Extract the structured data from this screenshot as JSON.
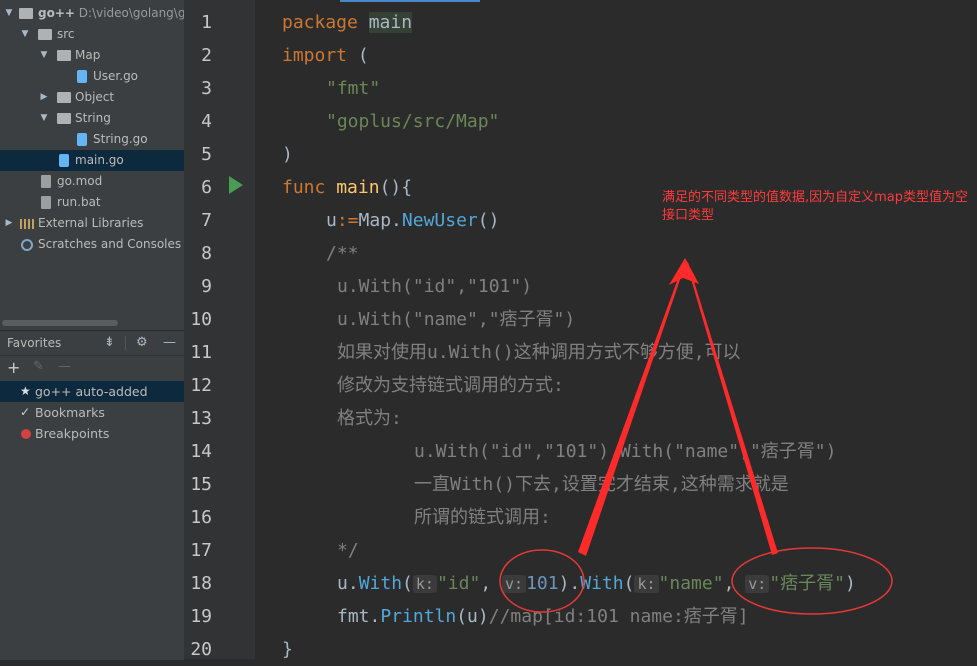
{
  "project_tree": [
    {
      "label": "go++",
      "path": "D:\\video\\golang\\g",
      "type": "root",
      "expanded": true
    },
    {
      "label": "src",
      "type": "folder",
      "expanded": true
    },
    {
      "label": "Map",
      "type": "folder",
      "expanded": true
    },
    {
      "label": "User.go",
      "type": "gofile"
    },
    {
      "label": "Object",
      "type": "folder",
      "expanded": false
    },
    {
      "label": "String",
      "type": "folder",
      "expanded": true
    },
    {
      "label": "String.go",
      "type": "gofile"
    },
    {
      "label": "main.go",
      "type": "gofile",
      "selected": true
    },
    {
      "label": "go.mod",
      "type": "modfile"
    },
    {
      "label": "run.bat",
      "type": "modfile"
    },
    {
      "label": "External Libraries",
      "type": "extlib",
      "expanded": false
    },
    {
      "label": "Scratches and Consoles",
      "type": "scratch"
    }
  ],
  "favorites": {
    "title": "Favorites",
    "items": [
      {
        "label": "go++  auto-added",
        "icon": "star-icon",
        "selected": true
      },
      {
        "label": "Bookmarks",
        "icon": "check-icon"
      },
      {
        "label": "Breakpoints",
        "icon": "breakpoint-icon"
      }
    ]
  },
  "line_numbers": [
    "1",
    "2",
    "3",
    "4",
    "5",
    "6",
    "7",
    "8",
    "9",
    "10",
    "11",
    "12",
    "13",
    "14",
    "15",
    "16",
    "17",
    "18",
    "19",
    "20"
  ],
  "code": {
    "l1_kw": "package",
    "l1_name": "main",
    "l2_kw": "import",
    "l2_paren": " (",
    "l3_str": "\"fmt\"",
    "l4_str": "\"goplus/src/Map\"",
    "l5": ")",
    "l6_kw": "func",
    "l6_fn": "main",
    "l6_rest": "(){",
    "l7_a": "u",
    "l7_op": ":=",
    "l7_b": "Map.",
    "l7_c": "NewUser",
    "l7_d": "()",
    "l8": "/**",
    "l9": "u.With(\"id\",\"101\")",
    "l10": "u.With(\"name\",\"痞子胥\")",
    "l11": "如果对使用u.With()这种调用方式不够方便,可以",
    "l12": "修改为支持链式调用的方式:",
    "l13": "格式为:",
    "l14": "u.With(\"id\",\"101\").With(\"name\",\"痞子胥\")",
    "l15": "一直With()下去,设置完才结束,这种需求就是",
    "l16": "所谓的链式调用:",
    "l17": "*/",
    "l18_a": "u.",
    "l18_b": "With",
    "l18_c": "(",
    "l18_hint1": "k:",
    "l18_s1": "\"id\"",
    "l18_d": ", ",
    "l18_hint2": "v:",
    "l18_n": "101",
    "l18_e": ").",
    "l18_f": "With",
    "l18_g": "(",
    "l18_hint3": "k:",
    "l18_s2": "\"name\"",
    "l18_h": ", ",
    "l18_hint4": "v:",
    "l18_s3": "\"痞子胥\"",
    "l18_i": ")",
    "l19_a": "fmt.",
    "l19_b": "Println",
    "l19_c": "(u)",
    "l19_cm": "//map[id:101 name:痞子胥]",
    "l20": "}"
  },
  "annotation": {
    "text": "满足的不同类型的值数据,因为自定义map类型值为空接口类型",
    "color": "#ff3b3b"
  }
}
